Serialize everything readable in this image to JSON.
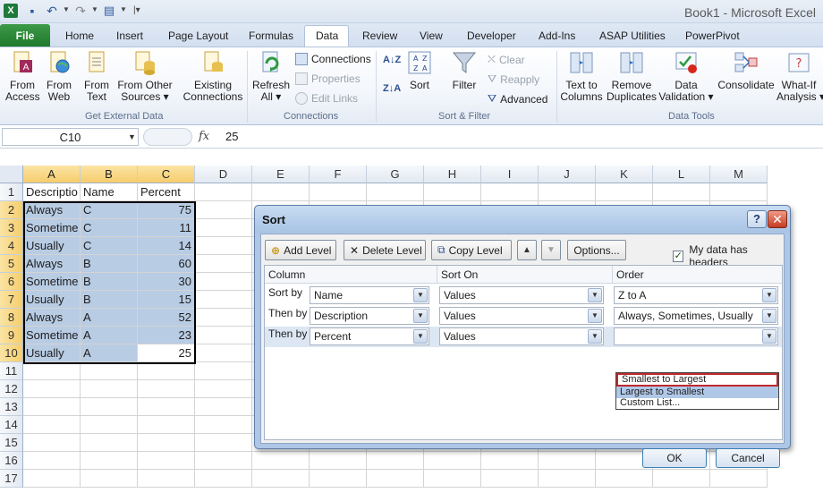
{
  "window": {
    "title": "Book1  -  Microsoft Excel"
  },
  "tabs": [
    "File",
    "Home",
    "Insert",
    "Page Layout",
    "Formulas",
    "Data",
    "Review",
    "View",
    "Developer",
    "Add-Ins",
    "ASAP Utilities",
    "PowerPivot"
  ],
  "active_tab": "Data",
  "ribbon": {
    "get_external": {
      "from_access": "From\nAccess",
      "from_web": "From\nWeb",
      "from_text": "From\nText",
      "from_other": "From Other\nSources ▾",
      "existing": "Existing\nConnections",
      "label": "Get External Data"
    },
    "connections": {
      "refresh_all": "Refresh\nAll ▾",
      "connections": "Connections",
      "properties": "Properties",
      "edit_links": "Edit Links",
      "label": "Connections"
    },
    "sort_filter": {
      "sort": "Sort",
      "filter": "Filter",
      "clear": "Clear",
      "reapply": "Reapply",
      "advanced": "Advanced",
      "label": "Sort & Filter"
    },
    "data_tools": {
      "text_to_columns": "Text to\nColumns",
      "remove_duplicates": "Remove\nDuplicates",
      "data_validation": "Data\nValidation ▾",
      "consolidate": "Consolidate",
      "what_if": "What-If\nAnalysis ▾",
      "label": "Data Tools"
    }
  },
  "formula_bar": {
    "name_box": "C10",
    "value": "25"
  },
  "sheet": {
    "columns": [
      "A",
      "B",
      "C",
      "D",
      "E",
      "F",
      "G",
      "H",
      "I",
      "J",
      "K",
      "L",
      "M"
    ],
    "rows": [
      "1",
      "2",
      "3",
      "4",
      "5",
      "6",
      "7",
      "8",
      "9",
      "10",
      "11",
      "12",
      "13",
      "14",
      "15",
      "16",
      "17"
    ],
    "header_row": [
      "Descriptio",
      "Name",
      "Percent"
    ],
    "data": [
      [
        "Always",
        "C",
        "75"
      ],
      [
        "Sometime",
        "C",
        "11"
      ],
      [
        "Usually",
        "C",
        "14"
      ],
      [
        "Always",
        "B",
        "60"
      ],
      [
        "Sometime",
        "B",
        "30"
      ],
      [
        "Usually",
        "B",
        "15"
      ],
      [
        "Always",
        "A",
        "52"
      ],
      [
        "Sometime",
        "A",
        "23"
      ],
      [
        "Usually",
        "A",
        "25"
      ]
    ]
  },
  "sort_dialog": {
    "title": "Sort",
    "help": "?",
    "close": "✕",
    "add_level": "Add Level",
    "delete_level": "Delete Level",
    "copy_level": "Copy Level",
    "options": "Options...",
    "my_data_has_headers": "My data has headers",
    "headers_checked": true,
    "col_header": "Column",
    "sorton_header": "Sort On",
    "order_header": "Order",
    "levels": [
      {
        "label": "Sort by",
        "column": "Name",
        "sort_on": "Values",
        "order": "Z to A"
      },
      {
        "label": "Then by",
        "column": "Description",
        "sort_on": "Values",
        "order": "Always, Sometimes, Usually"
      },
      {
        "label": "Then by",
        "column": "Percent",
        "sort_on": "Values",
        "order": ""
      }
    ],
    "order_options": [
      "Smallest to Largest",
      "Largest to Smallest",
      "Custom List..."
    ],
    "ok": "OK",
    "cancel": "Cancel"
  }
}
